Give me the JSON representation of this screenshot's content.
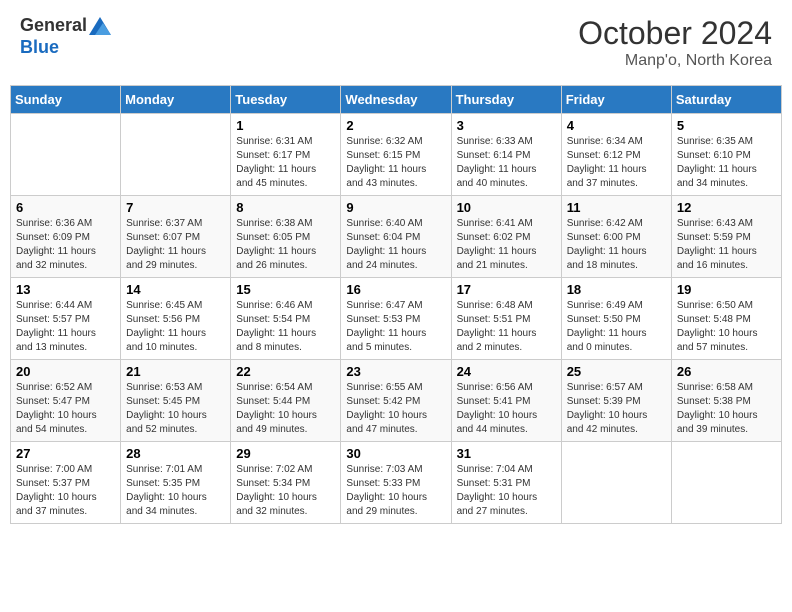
{
  "header": {
    "logo_line1": "General",
    "logo_line2": "Blue",
    "month_title": "October 2024",
    "location": "Manp'o, North Korea"
  },
  "days_of_week": [
    "Sunday",
    "Monday",
    "Tuesday",
    "Wednesday",
    "Thursday",
    "Friday",
    "Saturday"
  ],
  "weeks": [
    [
      {
        "day": "",
        "info": ""
      },
      {
        "day": "",
        "info": ""
      },
      {
        "day": "1",
        "info": "Sunrise: 6:31 AM\nSunset: 6:17 PM\nDaylight: 11 hours and 45 minutes."
      },
      {
        "day": "2",
        "info": "Sunrise: 6:32 AM\nSunset: 6:15 PM\nDaylight: 11 hours and 43 minutes."
      },
      {
        "day": "3",
        "info": "Sunrise: 6:33 AM\nSunset: 6:14 PM\nDaylight: 11 hours and 40 minutes."
      },
      {
        "day": "4",
        "info": "Sunrise: 6:34 AM\nSunset: 6:12 PM\nDaylight: 11 hours and 37 minutes."
      },
      {
        "day": "5",
        "info": "Sunrise: 6:35 AM\nSunset: 6:10 PM\nDaylight: 11 hours and 34 minutes."
      }
    ],
    [
      {
        "day": "6",
        "info": "Sunrise: 6:36 AM\nSunset: 6:09 PM\nDaylight: 11 hours and 32 minutes."
      },
      {
        "day": "7",
        "info": "Sunrise: 6:37 AM\nSunset: 6:07 PM\nDaylight: 11 hours and 29 minutes."
      },
      {
        "day": "8",
        "info": "Sunrise: 6:38 AM\nSunset: 6:05 PM\nDaylight: 11 hours and 26 minutes."
      },
      {
        "day": "9",
        "info": "Sunrise: 6:40 AM\nSunset: 6:04 PM\nDaylight: 11 hours and 24 minutes."
      },
      {
        "day": "10",
        "info": "Sunrise: 6:41 AM\nSunset: 6:02 PM\nDaylight: 11 hours and 21 minutes."
      },
      {
        "day": "11",
        "info": "Sunrise: 6:42 AM\nSunset: 6:00 PM\nDaylight: 11 hours and 18 minutes."
      },
      {
        "day": "12",
        "info": "Sunrise: 6:43 AM\nSunset: 5:59 PM\nDaylight: 11 hours and 16 minutes."
      }
    ],
    [
      {
        "day": "13",
        "info": "Sunrise: 6:44 AM\nSunset: 5:57 PM\nDaylight: 11 hours and 13 minutes."
      },
      {
        "day": "14",
        "info": "Sunrise: 6:45 AM\nSunset: 5:56 PM\nDaylight: 11 hours and 10 minutes."
      },
      {
        "day": "15",
        "info": "Sunrise: 6:46 AM\nSunset: 5:54 PM\nDaylight: 11 hours and 8 minutes."
      },
      {
        "day": "16",
        "info": "Sunrise: 6:47 AM\nSunset: 5:53 PM\nDaylight: 11 hours and 5 minutes."
      },
      {
        "day": "17",
        "info": "Sunrise: 6:48 AM\nSunset: 5:51 PM\nDaylight: 11 hours and 2 minutes."
      },
      {
        "day": "18",
        "info": "Sunrise: 6:49 AM\nSunset: 5:50 PM\nDaylight: 11 hours and 0 minutes."
      },
      {
        "day": "19",
        "info": "Sunrise: 6:50 AM\nSunset: 5:48 PM\nDaylight: 10 hours and 57 minutes."
      }
    ],
    [
      {
        "day": "20",
        "info": "Sunrise: 6:52 AM\nSunset: 5:47 PM\nDaylight: 10 hours and 54 minutes."
      },
      {
        "day": "21",
        "info": "Sunrise: 6:53 AM\nSunset: 5:45 PM\nDaylight: 10 hours and 52 minutes."
      },
      {
        "day": "22",
        "info": "Sunrise: 6:54 AM\nSunset: 5:44 PM\nDaylight: 10 hours and 49 minutes."
      },
      {
        "day": "23",
        "info": "Sunrise: 6:55 AM\nSunset: 5:42 PM\nDaylight: 10 hours and 47 minutes."
      },
      {
        "day": "24",
        "info": "Sunrise: 6:56 AM\nSunset: 5:41 PM\nDaylight: 10 hours and 44 minutes."
      },
      {
        "day": "25",
        "info": "Sunrise: 6:57 AM\nSunset: 5:39 PM\nDaylight: 10 hours and 42 minutes."
      },
      {
        "day": "26",
        "info": "Sunrise: 6:58 AM\nSunset: 5:38 PM\nDaylight: 10 hours and 39 minutes."
      }
    ],
    [
      {
        "day": "27",
        "info": "Sunrise: 7:00 AM\nSunset: 5:37 PM\nDaylight: 10 hours and 37 minutes."
      },
      {
        "day": "28",
        "info": "Sunrise: 7:01 AM\nSunset: 5:35 PM\nDaylight: 10 hours and 34 minutes."
      },
      {
        "day": "29",
        "info": "Sunrise: 7:02 AM\nSunset: 5:34 PM\nDaylight: 10 hours and 32 minutes."
      },
      {
        "day": "30",
        "info": "Sunrise: 7:03 AM\nSunset: 5:33 PM\nDaylight: 10 hours and 29 minutes."
      },
      {
        "day": "31",
        "info": "Sunrise: 7:04 AM\nSunset: 5:31 PM\nDaylight: 10 hours and 27 minutes."
      },
      {
        "day": "",
        "info": ""
      },
      {
        "day": "",
        "info": ""
      }
    ]
  ]
}
